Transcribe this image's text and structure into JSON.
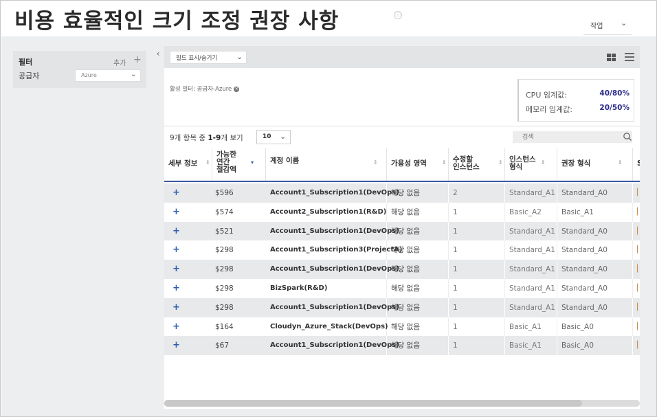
{
  "page": {
    "title": "비용 효율적인 크기 조정 권장 사항",
    "info_icon": "ⓘ",
    "action_label": "작업",
    "chevron": "⌄"
  },
  "filter_panel": {
    "title": "필터",
    "add_label": "추가",
    "add_icon": "+",
    "provider_label": "공급자",
    "provider_value": "Azure"
  },
  "toolbar": {
    "collapse_icon": "‹",
    "field_toggle_label": "필드 표시/숨기기"
  },
  "active_filter": {
    "label": "활성 필터: 공급자-Azure",
    "remove_icon": "✕"
  },
  "thresholds": {
    "cpu_label": "CPU 임계값:",
    "cpu_value": "40/80%",
    "memory_label": "메모리 임계값:",
    "memory_value": "20/50%"
  },
  "paging": {
    "prefix": "9개 항목 중 ",
    "range": "1-9",
    "suffix": "개  보기",
    "page_size": "10"
  },
  "search": {
    "placeholder": "검색"
  },
  "columns": {
    "details": "세부 정보",
    "savings": "가능한\n연간\n절감액",
    "account": "계정 이름",
    "zone": "가용성 영역",
    "instances": "수정할\n인스턴스",
    "instance_type": "인스턴스\n형식",
    "recommended": "권장 형식",
    "next": "S",
    "sort_icon": "⇕",
    "sort_desc_icon": "▾"
  },
  "rows": [
    {
      "expand": "+",
      "savings": "$596",
      "account": "Account1_Subscription1(DevOps)",
      "zone": "해당 없음",
      "instances": "2",
      "type": "Standard_A1",
      "recommended": "Standard_A0"
    },
    {
      "expand": "+",
      "savings": "$574",
      "account": "Account2_Subscription1(R&D)",
      "zone": "해당 없음",
      "instances": "1",
      "type": "Basic_A2",
      "recommended": "Basic_A1"
    },
    {
      "expand": "+",
      "savings": "$521",
      "account": "Account1_Subscription1(DevOps)",
      "zone": "해당 없음",
      "instances": "1",
      "type": "Standard_A1",
      "recommended": "Standard_A0"
    },
    {
      "expand": "+",
      "savings": "$298",
      "account": "Account1_Subscription3(ProjectA)",
      "zone": "해당 없음",
      "instances": "1",
      "type": "Standard_A1",
      "recommended": "Standard_A0"
    },
    {
      "expand": "+",
      "savings": "$298",
      "account": "Account1_Subscription1(DevOps)",
      "zone": "해당 없음",
      "instances": "1",
      "type": "Standard_A1",
      "recommended": "Standard_A0"
    },
    {
      "expand": "+",
      "savings": "$298",
      "account": "BizSpark(R&D)",
      "zone": "해당 없음",
      "instances": "1",
      "type": "Standard_A1",
      "recommended": "Standard_A0"
    },
    {
      "expand": "+",
      "savings": "$298",
      "account": "Account1_Subscription1(DevOps)",
      "zone": "해당 없음",
      "instances": "1",
      "type": "Standard_A1",
      "recommended": "Standard_A0"
    },
    {
      "expand": "+",
      "savings": "$164",
      "account": "Cloudyn_Azure_Stack(DevOps)",
      "zone": "해당 없음",
      "instances": "1",
      "type": "Basic_A1",
      "recommended": "Basic_A0"
    },
    {
      "expand": "+",
      "savings": "$67",
      "account": "Account1_Subscription1(DevOps)",
      "zone": "해당 없음",
      "instances": "1",
      "type": "Basic_A1",
      "recommended": "Basic_A0"
    }
  ],
  "colors": {
    "accent": "#2a5fb0",
    "header_rule": "#3a5aa0",
    "threshold_value": "#2c2c8c"
  }
}
